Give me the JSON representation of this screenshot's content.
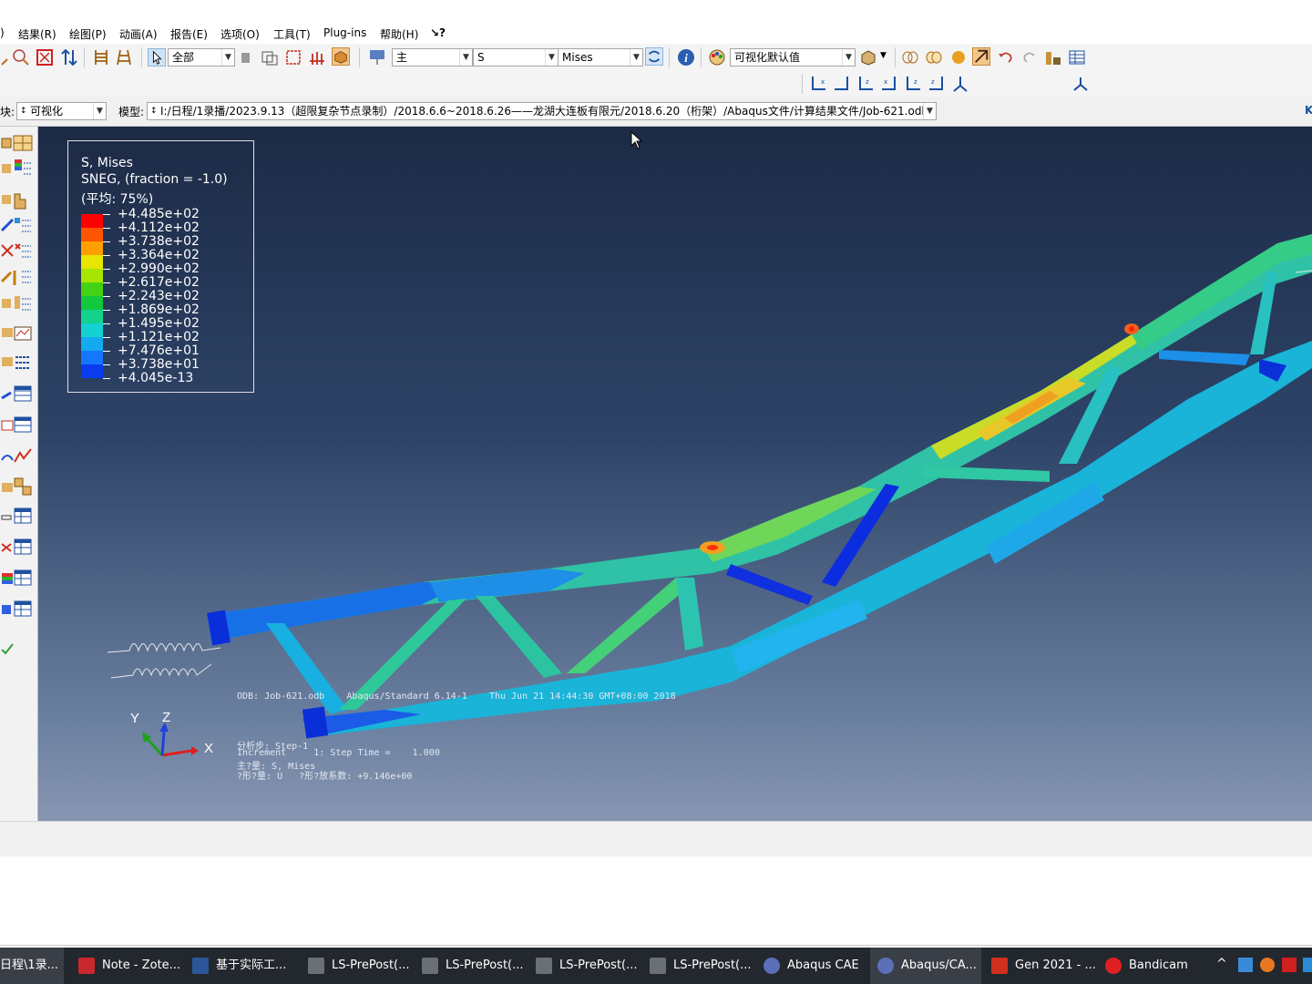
{
  "menu": {
    "items": [
      ")",
      "结果(R)",
      "绘图(P)",
      "动画(A)",
      "报告(E)",
      "选项(O)",
      "工具(T)",
      "Plug-ins",
      "帮助(H)",
      "↘?"
    ]
  },
  "toolbar": {
    "select_filter": "全部",
    "field_primary": "主",
    "field_variable": "S",
    "field_invariant": "Mises",
    "visual_defaults": "可视化默认值",
    "numbered_views": [
      "1",
      "2",
      "3",
      "4"
    ]
  },
  "context_bar": {
    "module_label": "块:",
    "module_value": "可视化",
    "model_label": "模型:",
    "model_value": "I:/日程/1录播/2023.9.13（超限复杂节点录制）/2018.6.6~2018.6.26——龙湖大连板有限元/2018.6.20（桁架）/Abaqus文件/计算结果文件/Job-621.odb",
    "right_marker": "K"
  },
  "legend": {
    "title": "S, Mises",
    "subtitle": "SNEG, (fraction = -1.0)",
    "averaging": "(平均: 75%)",
    "levels": [
      "+4.485e+02",
      "+4.112e+02",
      "+3.738e+02",
      "+3.364e+02",
      "+2.990e+02",
      "+2.617e+02",
      "+2.243e+02",
      "+1.869e+02",
      "+1.495e+02",
      "+1.121e+02",
      "+7.476e+01",
      "+3.738e+01",
      "+4.045e-13"
    ],
    "colors": [
      "#ff0000",
      "#ff5500",
      "#ffa000",
      "#e6e600",
      "#a8e600",
      "#46d214",
      "#12c83c",
      "#12d28c",
      "#14d2d2",
      "#14aaf0",
      "#1478ff",
      "#0a3cf0",
      "#0000e6"
    ]
  },
  "viewport_info": {
    "odb_line": "ODB: Job-621.odb    Abaqus/Standard 6.14-1    Thu Jun 21 14:44:30 GMT+08:00 2018",
    "step_line": "分析步: Step-1",
    "increment_line": "Increment     1: Step Time =    1.000",
    "primary_var_line": "主?量: S, Mises",
    "deform_line": "?形?量: U   ?形?放系数: +9.146e+00"
  },
  "triad": {
    "x": "X",
    "y": "Y",
    "z": "Z"
  },
  "taskbar": {
    "items": [
      "日程\\1录...",
      "Note - Zote...",
      "基于实际工...",
      "LS-PrePost(...",
      "LS-PrePost(...",
      "LS-PrePost(...",
      "LS-PrePost(...",
      "Abaqus CAE",
      "Abaqus/CA...",
      "Gen 2021 - ...",
      "Bandicam"
    ]
  }
}
